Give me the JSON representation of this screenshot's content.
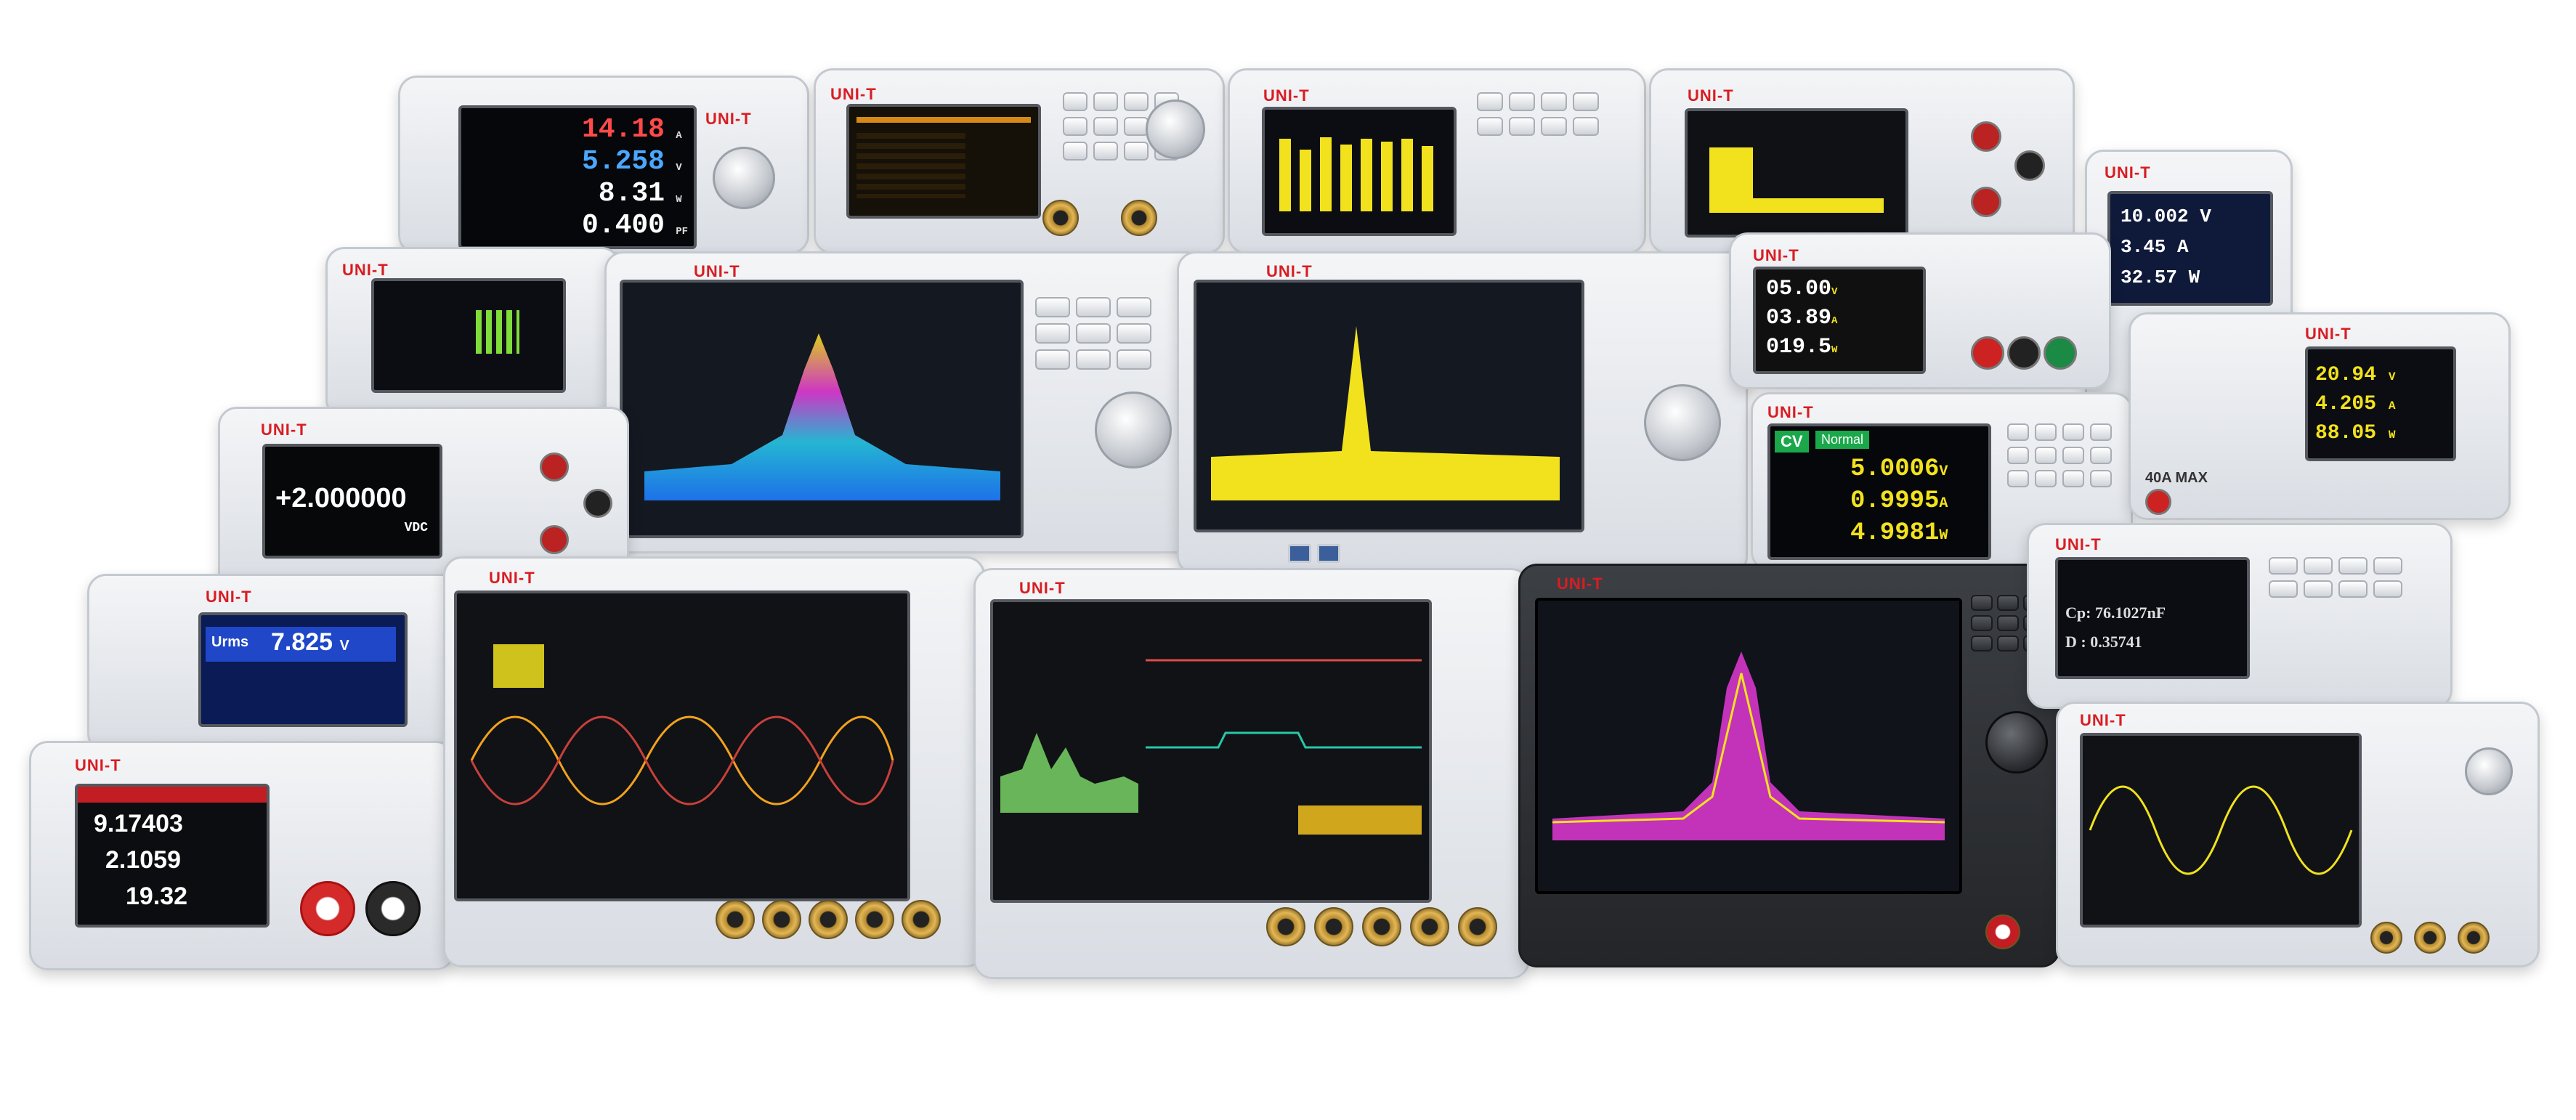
{
  "brand": "UNI-T",
  "colors": {
    "brand_red": "#d81d22",
    "trace_yellow": "#f2e21d",
    "trace_cyan": "#27c7e6",
    "trace_magenta": "#e23ad7",
    "trace_green": "#7ee06a",
    "vfd_blue": "#1f47c8"
  },
  "power_meter_top": {
    "readings": [
      {
        "value": "14.18",
        "unit": "A",
        "color": "#ff4a4a"
      },
      {
        "value": "5.258",
        "unit": "V",
        "color": "#4aa8ff"
      },
      {
        "value": "8.31",
        "unit": "W",
        "color": "#ffffff"
      },
      {
        "value": "0.400",
        "unit": "PF",
        "color": "#ffffff"
      }
    ]
  },
  "dmm_left": {
    "reading": "+2.000000",
    "unit": "VDC"
  },
  "power_meter_blue": {
    "label": "Urms",
    "reading": "7.825",
    "unit": "V"
  },
  "dc_load": {
    "readings": [
      "9.17403",
      "2.1059",
      "19.32"
    ]
  },
  "psu_small": {
    "readings": [
      {
        "value": "05.00",
        "unit": "V"
      },
      {
        "value": "03.89",
        "unit": "A"
      },
      {
        "value": "019.5",
        "unit": "W"
      }
    ]
  },
  "psu_cv": {
    "mode": "CV",
    "status": "Normal",
    "readings": [
      {
        "value": "5.0006",
        "unit": "V"
      },
      {
        "value": "0.9995",
        "unit": "A"
      },
      {
        "value": "4.9981",
        "unit": "W"
      }
    ]
  },
  "psu_right_top": {
    "readings": [
      {
        "value": "10.002",
        "unit": "V"
      },
      {
        "value": "3.45",
        "unit": "A"
      },
      {
        "value": "32.57",
        "unit": "W"
      }
    ]
  },
  "psu_right_mid": {
    "readings": [
      {
        "value": "20.94",
        "unit": "V"
      },
      {
        "value": "4.205",
        "unit": "A"
      },
      {
        "value": "88.05",
        "unit": "W"
      }
    ],
    "max_label": "40A MAX"
  },
  "lcr_meter": {
    "line1": "Cp: 76.1027nF",
    "line2": "D : 0.35741"
  }
}
